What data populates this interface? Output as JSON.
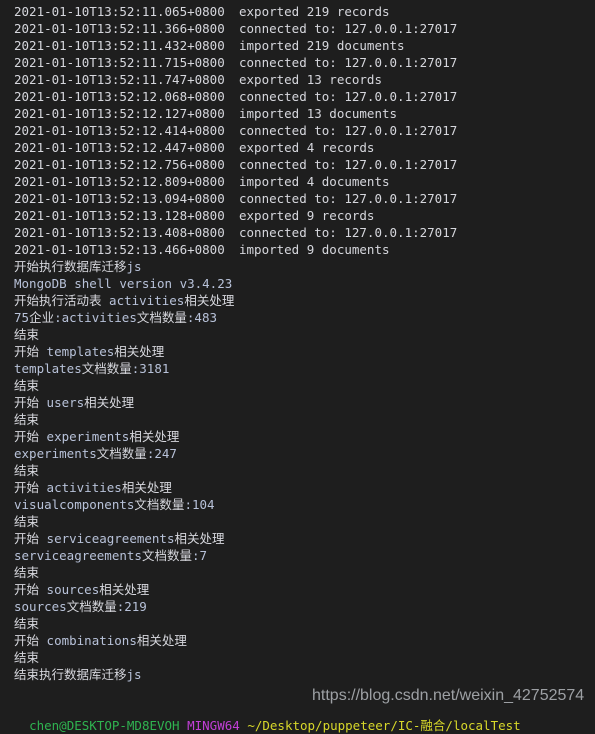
{
  "terminal": {
    "background_color": "#1e1e1e",
    "foreground_color": "#d6d7dd",
    "log_lines": [
      {
        "timestamp": "2021-01-10T13:52:11.065+0800",
        "message": "exported 219 records"
      },
      {
        "timestamp": "2021-01-10T13:52:11.366+0800",
        "message": "connected to: 127.0.0.1:27017"
      },
      {
        "timestamp": "2021-01-10T13:52:11.432+0800",
        "message": "imported 219 documents"
      },
      {
        "timestamp": "2021-01-10T13:52:11.715+0800",
        "message": "connected to: 127.0.0.1:27017"
      },
      {
        "timestamp": "2021-01-10T13:52:11.747+0800",
        "message": "exported 13 records"
      },
      {
        "timestamp": "2021-01-10T13:52:12.068+0800",
        "message": "connected to: 127.0.0.1:27017"
      },
      {
        "timestamp": "2021-01-10T13:52:12.127+0800",
        "message": "imported 13 documents"
      },
      {
        "timestamp": "2021-01-10T13:52:12.414+0800",
        "message": "connected to: 127.0.0.1:27017"
      },
      {
        "timestamp": "2021-01-10T13:52:12.447+0800",
        "message": "exported 4 records"
      },
      {
        "timestamp": "2021-01-10T13:52:12.756+0800",
        "message": "connected to: 127.0.0.1:27017"
      },
      {
        "timestamp": "2021-01-10T13:52:12.809+0800",
        "message": "imported 4 documents"
      },
      {
        "timestamp": "2021-01-10T13:52:13.094+0800",
        "message": "connected to: 127.0.0.1:27017"
      },
      {
        "timestamp": "2021-01-10T13:52:13.128+0800",
        "message": "exported 9 records"
      },
      {
        "timestamp": "2021-01-10T13:52:13.408+0800",
        "message": "connected to: 127.0.0.1:27017"
      },
      {
        "timestamp": "2021-01-10T13:52:13.466+0800",
        "message": "imported 9 documents"
      }
    ],
    "output_lines": [
      "开始执行数据库迁移js",
      "MongoDB shell version v3.4.23",
      "开始执行活动表 activities相关处理",
      "75企业:activities文档数量:483",
      "结束",
      "开始 templates相关处理",
      "templates文档数量:3181",
      "结束",
      "开始 users相关处理",
      "结束",
      "开始 experiments相关处理",
      "experiments文档数量:247",
      "结束",
      "开始 activities相关处理",
      "visualcomponents文档数量:104",
      "结束",
      "开始 serviceagreements相关处理",
      "serviceagreements文档数量:7",
      "结束",
      "开始 sources相关处理",
      "sources文档数量:219",
      "结束",
      "开始 combinations相关处理",
      "结束",
      "结束执行数据库迁移js"
    ]
  },
  "prompt": {
    "user_host": "chen@DESKTOP-MD8EVOH",
    "shell": "MINGW64",
    "path": "~/Desktop/puppeteer/IC-融合/localTest",
    "user_color": "#2fb350",
    "shell_color": "#c13fd6",
    "path_color": "#d8d82a"
  },
  "watermark": {
    "text": "https://blog.csdn.net/weixin_42752574"
  }
}
